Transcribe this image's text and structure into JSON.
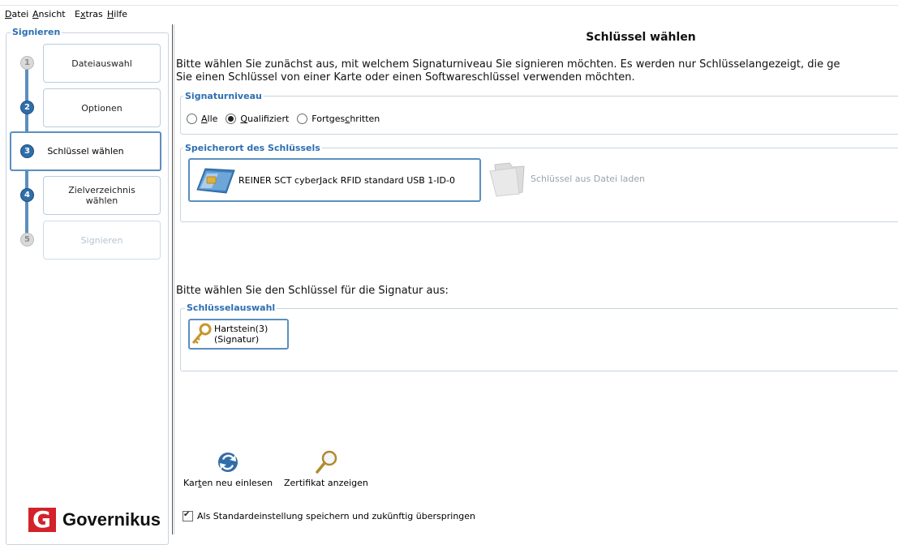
{
  "menu": [
    {
      "label": "Datei",
      "mnemonic": "D"
    },
    {
      "label": "Ansicht",
      "mnemonic": "A"
    },
    {
      "label": "Extras",
      "mnemonic": "x"
    },
    {
      "label": "Hilfe",
      "mnemonic": "H"
    }
  ],
  "sidebar": {
    "legend": "Signieren",
    "steps": [
      {
        "num": "1",
        "label": "Dateiauswahl",
        "state": "done"
      },
      {
        "num": "2",
        "label": "Optionen",
        "state": "done"
      },
      {
        "num": "3",
        "label": "Schlüssel wählen",
        "state": "active"
      },
      {
        "num": "4",
        "label": "Zielverzeichnis wählen",
        "state": "pending"
      },
      {
        "num": "5",
        "label": "Signieren",
        "state": "disabled"
      }
    ],
    "logo_text": "Governikus",
    "logo_mark": "G"
  },
  "main": {
    "title": "Schlüssel wählen",
    "description_line1": "Bitte wählen Sie zunächst aus, mit welchem Signaturniveau Sie signieren möchten. Es werden nur Schlüsselangezeigt, die ge",
    "description_line2": "Sie einen Schlüssel von einer Karte oder einen Softwareschlüssel verwenden möchten.",
    "signaturniveau": {
      "legend": "Signaturniveau",
      "options": [
        "Alle",
        "Qualifiziert",
        "Fortgeschritten"
      ],
      "selected": "Qualifiziert"
    },
    "speicherort": {
      "legend": "Speicherort des Schlüssels",
      "card_reader_label": "REINER SCT cyberJack RFID standard USB 1-ID-0",
      "file_label": "Schlüssel aus Datei laden"
    },
    "choose_label": "Bitte wählen Sie den Schlüssel für die Signatur aus:",
    "schluesselauswahl": {
      "legend": "Schlüsselauswahl",
      "key_line1": "Hartstein(3)",
      "key_line2": "(Signatur)"
    },
    "actions": {
      "reload_label": "Karten neu einlesen",
      "certificate_label": "Zertifikat anzeigen"
    },
    "checkbox_label": "Als Standardeinstellung speichern und zukünftig überspringen",
    "checkbox_checked": true
  }
}
